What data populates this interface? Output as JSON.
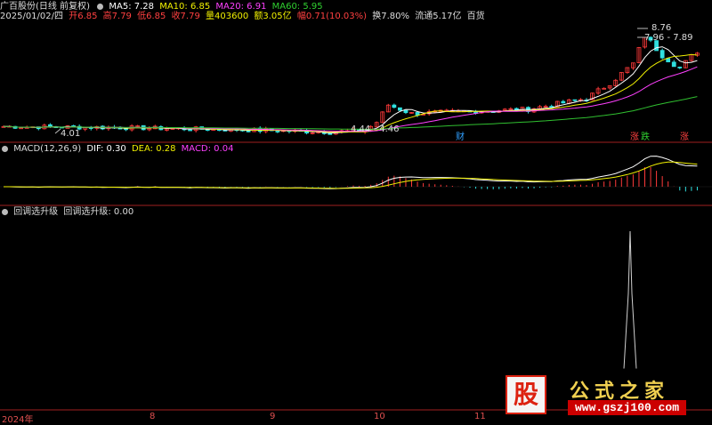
{
  "stock": {
    "name": "广百股份(日线 前复权)",
    "ma5": "MA5: 7.28",
    "ma10": "MA10: 6.85",
    "ma20": "MA20: 6.91",
    "ma60": "MA60: 5.95",
    "date": "2025/01/02/四",
    "open": "开6.85",
    "high": "高7.79",
    "low": "低6.85",
    "close": "收7.79",
    "volume": "量403600",
    "amount": "额3.05亿",
    "change": "幅0.71(10.03%)",
    "turnover": "换7.80%",
    "float": "流通5.17亿",
    "industry": "百货"
  },
  "annotations": {
    "high_label": "8.76",
    "range_top": "7.96 - 7.89",
    "low_label": "4.01",
    "range_mid": "4.44 - 4.46",
    "sig_cai1": "财",
    "sig_zhang": "涨",
    "sig_die": "跌",
    "sig_zhang2": "涨"
  },
  "macd": {
    "title": "MACD(12,26,9)",
    "dif": "DIF: 0.30",
    "dea": "DEA: 0.28",
    "macd": "MACD: 0.04"
  },
  "indicator": {
    "title": "回调选升级",
    "label": "回调选升级: 0.00"
  },
  "xaxis": [
    "2024年",
    "8",
    "9",
    "10",
    "11"
  ],
  "colors": {
    "up": "#ff3a3a",
    "down": "#30e0e0",
    "ma5": "#ffffff",
    "ma10": "#f0f000",
    "ma20": "#ff40ff",
    "ma60": "#30c030",
    "separator": "#a02020",
    "indicator_line": "#d0d0d0"
  },
  "logo": {
    "char": "股",
    "name": "公式之家",
    "url": "www.gszj100.com"
  },
  "chart_data": [
    {
      "type": "candlestick",
      "title": "",
      "series": [
        {
          "name": "MA5",
          "values": []
        },
        {
          "name": "MA10",
          "values": []
        },
        {
          "name": "MA20",
          "values": []
        },
        {
          "name": "MA60",
          "values": []
        }
      ],
      "period_close_estimates": {
        "x": [
          "2024-07",
          "2024-08",
          "2024-09",
          "2024-10",
          "2024-11",
          "2025-01"
        ],
        "y": [
          4.3,
          4.2,
          4.4,
          5.3,
          6.2,
          7.79
        ]
      }
    },
    {
      "type": "line",
      "title": "MACD(12,26,9)",
      "series": [
        {
          "name": "DIF",
          "last": 0.3
        },
        {
          "name": "DEA",
          "last": 0.28
        },
        {
          "name": "MACD",
          "last": 0.04
        }
      ]
    },
    {
      "type": "line",
      "title": "回调选升级",
      "series": [
        {
          "name": "回调选升级",
          "last": 0.0,
          "spike_position": "near right end"
        }
      ]
    }
  ]
}
